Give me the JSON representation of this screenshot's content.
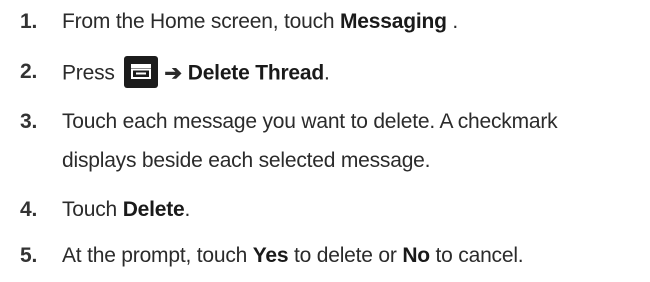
{
  "steps": [
    {
      "num": "1.",
      "pre": "From the Home screen, touch ",
      "bold": "Messaging",
      "post": " ."
    },
    {
      "num": "2.",
      "pre": "Press ",
      "icon": "menu-key-icon",
      "arrow": "➔",
      "bold": "Delete Thread",
      "post": "."
    },
    {
      "num": "3.",
      "line1": "Touch each message you want to delete. A checkmark",
      "line2": "displays beside each selected message."
    },
    {
      "num": "4.",
      "pre": "Touch ",
      "bold": "Delete",
      "post": "."
    },
    {
      "num": "5.",
      "pre": "At the prompt, touch ",
      "bold1": "Yes",
      "mid": " to delete or ",
      "bold2": "No",
      "post": " to cancel."
    }
  ]
}
